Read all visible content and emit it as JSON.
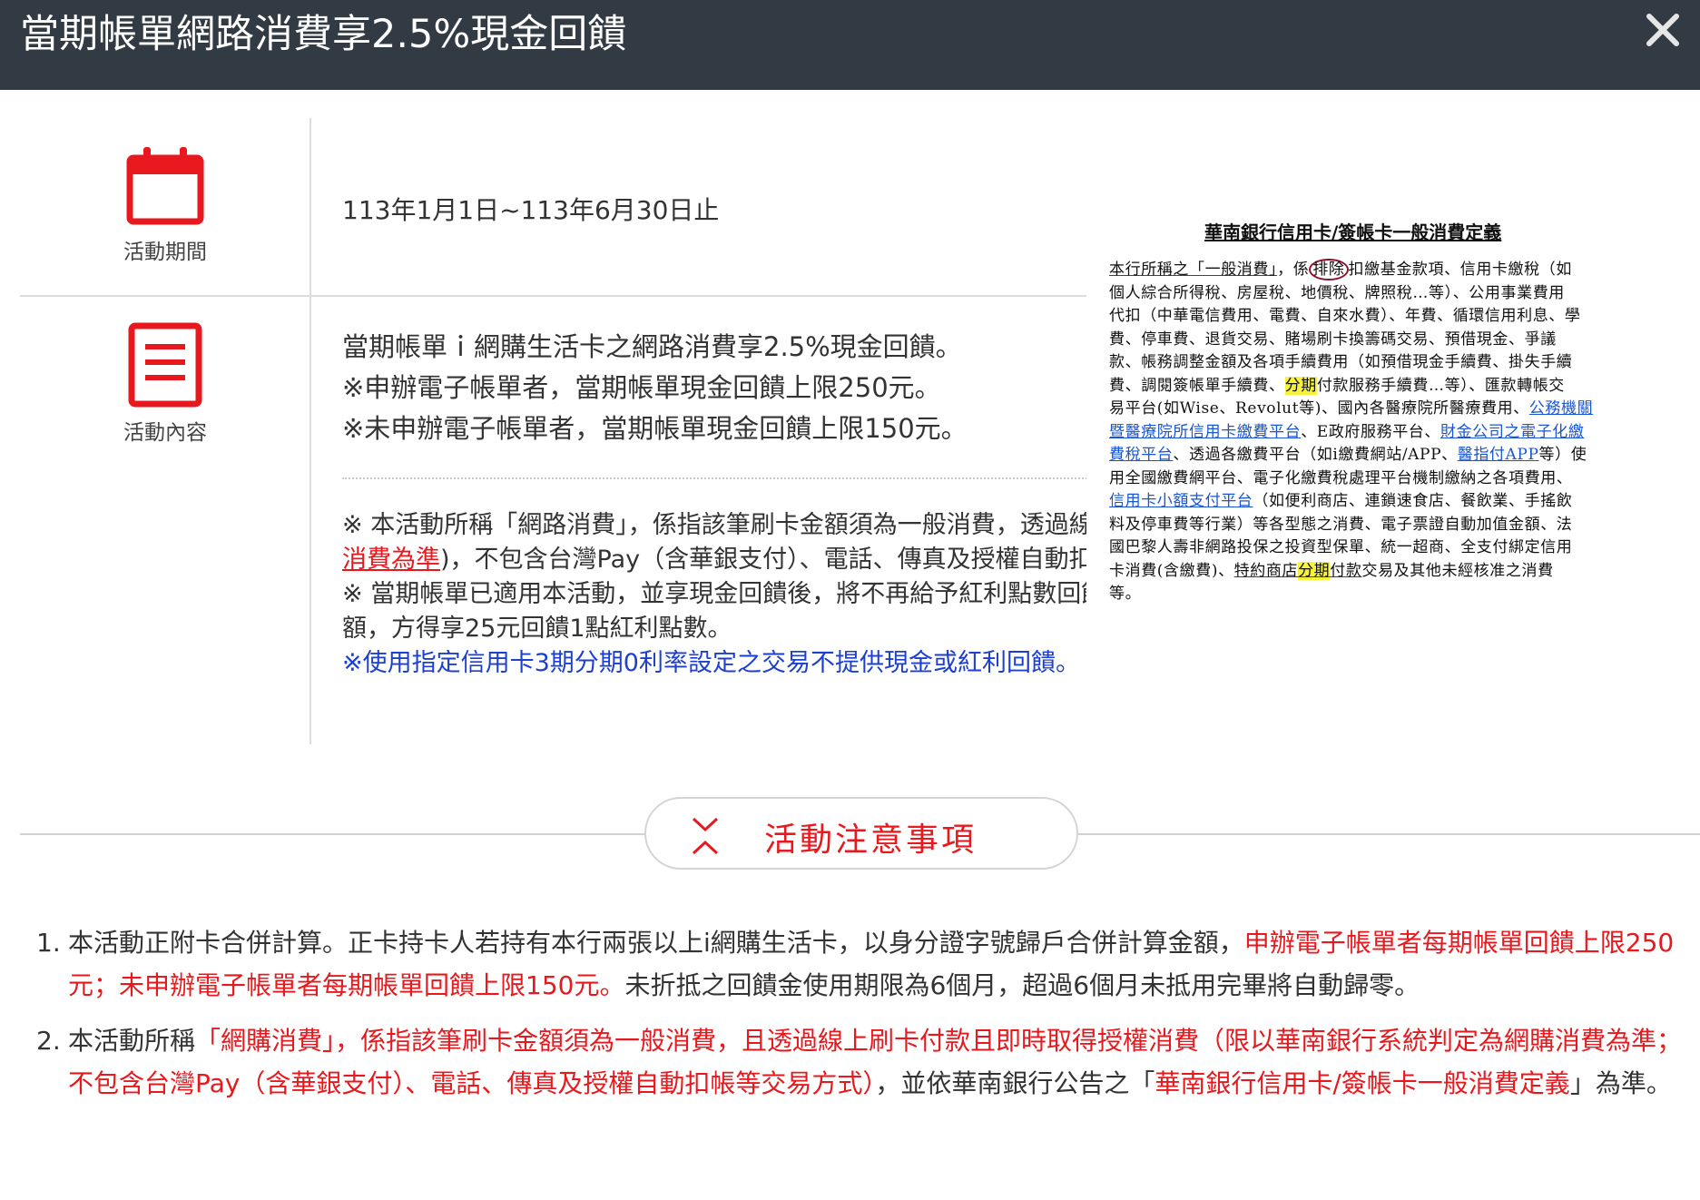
{
  "header": {
    "title": "當期帳單網路消費享2.5%現金回饋"
  },
  "period": {
    "label": "活動期間",
    "icon": "calendar-icon",
    "text": "113年1月1日~113年6月30日止"
  },
  "content": {
    "label": "活動內容",
    "icon": "document-icon",
    "lines": [
      "當期帳單ｉ網購生活卡之網路消費享2.5%現金回饋。",
      "※申辦電子帳單者，當期帳單現金回饋上限250元。",
      "※未申辦電子帳單者，當期帳單現金回饋上限150元。"
    ],
    "notes": {
      "n1_a": "※ 本活動所稱「網路消費」，係指該筆刷卡金額須為一般消費，透過線上刷卡付款即時取得授權消費(",
      "n1_red": "限以本行系統判定為網路消費為準",
      "n1_b": ")，不包含台灣Pay（含華銀支付）、電話、傳真及授權自動扣帳等交易方式。",
      "n2": "※ 當期帳單已適用本活動，並享現金回饋後，將不再給予紅利點數回饋，僅超過當期帳單現金回饋上限之網購通路一般消費金額，方得享25元回饋1點紅利點數。",
      "n3": "※使用指定信用卡3期分期0利率設定之交易不提供現金或紅利回饋。"
    }
  },
  "definition": {
    "title": "華南銀行信用卡/簽帳卡一般消費定義",
    "l1a": "本行所稱之「一般消費」",
    "l1b": "，係",
    "l1c": "排除",
    "l1d": "扣繳基金款項、信用卡繳稅（如",
    "l2": "個人綜合所得稅、房屋稅、地價稅、牌照稅…等）、公用事業費用",
    "l3": "代扣（中華電信費用、電費、自來水費）、年費、循環信用利息、學",
    "l4": "費、停車費、退貨交易、賭場刷卡換籌碼交易、預借現金、爭議",
    "l5": "款、帳務調整金額及各項手續費用（如預借現金手續費、掛失手續",
    "l6a": "費、調閱簽帳單手續費、",
    "l6b": "分期",
    "l6c": "付款服務手續費…等）、匯款轉帳交",
    "l7a": "易平台(如Wise、Revolut等)、國內各醫療院所醫療費用、",
    "l7b": "公務機關",
    "l8a": "暨醫療院所信用卡繳費平台",
    "l8b": "、E政府服務平台、",
    "l8c": "財金公司之電子化繳",
    "l9a": "費稅平台",
    "l9b": "、透過各繳費平台（如i繳費網站/APP、",
    "l9c": "醫指付APP",
    "l9d": "等）使",
    "l10": "用全國繳費網平台、電子化繳費稅處理平台機制繳納之各項費用、",
    "l11a": "信用卡小額支付平台",
    "l11b": "（如便利商店、連鎖速食店、餐飲業、手搖飲",
    "l12": "料及停車費等行業）等各型態之消費、電子票證自動加值金額、法",
    "l13": "國巴黎人壽非網路投保之投資型保單、統一超商、全支付綁定信用",
    "l14a": "卡消費(含繳費)、",
    "l14b": "特約商店",
    "l14c": "分期",
    "l14d": "付款",
    "l14e": "交易及其他未經核准之消費",
    "l15": "等。"
  },
  "notice": {
    "label": "活動注意事項",
    "icon": "collapse-chevron-icon"
  },
  "rules": [
    {
      "num": "1.",
      "a": "本活動正附卡合併計算。正卡持卡人若持有本行兩張以上i網購生活卡，以身分證字號歸戶合併計算金額，",
      "red": "申辦電子帳單者每期帳單回饋上限250元；未申辦電子帳單者每期帳單回饋上限150元。",
      "b": "未折抵之回饋金使用期限為6個月，超過6個月未抵用完畢將自動歸零。"
    },
    {
      "num": "2.",
      "a": "本活動所稱",
      "red": "「網購消費」，係指該筆刷卡金額須為一般消費，且透過線上刷卡付款且即時取得授權消費（限以華南銀行系統判定為網購消費為準；不包含台灣Pay（含華銀支付）、電話、傳真及授權自動扣帳等交易方式）",
      "b": "，並依華南銀行公告之「",
      "red2": "華南銀行信用卡/簽帳卡一般消費定義",
      "c": "」為準。"
    }
  ],
  "colors": {
    "header_bg": "#323b43",
    "accent_red": "#e8191e",
    "note_blue": "#1c3fd1",
    "link_blue": "#1a55d6"
  }
}
